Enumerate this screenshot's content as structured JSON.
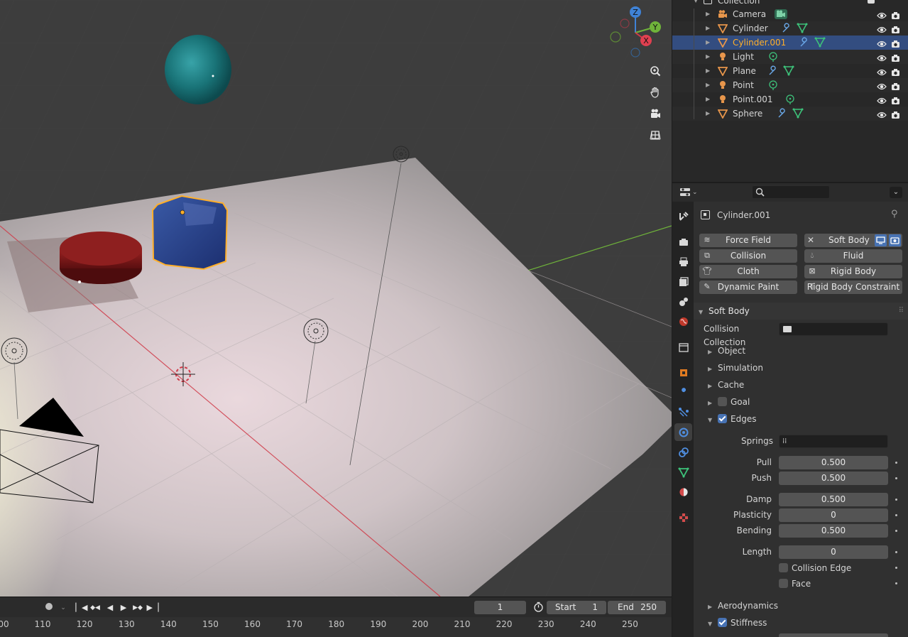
{
  "outliner": {
    "header_label": "Collection",
    "items": [
      {
        "name": "Camera",
        "type": "camera"
      },
      {
        "name": "Cylinder",
        "type": "mesh"
      },
      {
        "name": "Cylinder.001",
        "type": "mesh",
        "selected": true
      },
      {
        "name": "Light",
        "type": "light"
      },
      {
        "name": "Plane",
        "type": "mesh"
      },
      {
        "name": "Point",
        "type": "light"
      },
      {
        "name": "Point.001",
        "type": "light"
      },
      {
        "name": "Sphere",
        "type": "mesh"
      }
    ]
  },
  "properties": {
    "object_name": "Cylinder.001",
    "physics_buttons": {
      "force_field": "Force Field",
      "soft_body": "Soft Body",
      "collision": "Collision",
      "fluid": "Fluid",
      "cloth": "Cloth",
      "rigid_body": "Rigid Body",
      "dynamic_paint": "Dynamic Paint",
      "rigid_body_constraint": "Rigid Body Constraint"
    },
    "panel_title": "Soft Body",
    "collision_collection_label": "Collision Collection",
    "subpanels": {
      "object": "Object",
      "simulation": "Simulation",
      "cache": "Cache",
      "goal": "Goal",
      "edges": "Edges",
      "aerodynamics": "Aerodynamics",
      "stiffness": "Stiffness"
    },
    "edges": {
      "springs_label": "Springs",
      "pull_label": "Pull",
      "pull_value": "0.500",
      "push_label": "Push",
      "push_value": "0.500",
      "damp_label": "Damp",
      "damp_value": "0.500",
      "plasticity_label": "Plasticity",
      "plasticity_value": "0",
      "bending_label": "Bending",
      "bending_value": "0.500",
      "length_label": "Length",
      "length_value": "0",
      "collision_edge_label": "Collision Edge",
      "face_label": "Face"
    }
  },
  "timeline": {
    "current_frame": "1",
    "start_label": "Start",
    "start_value": "1",
    "end_label": "End",
    "end_value": "250",
    "ticks": [
      "00",
      "110",
      "120",
      "130",
      "140",
      "150",
      "160",
      "170",
      "180",
      "190",
      "200",
      "210",
      "220",
      "230",
      "240",
      "250"
    ]
  },
  "gizmo": {
    "z": "Z",
    "y": "Y",
    "x": "X"
  },
  "colors": {
    "selection": "#ffaf29",
    "selected_row": "#334d80",
    "accent_blue": "#4772b3",
    "x_axis": "#d03a48",
    "y_axis": "#6fb33a",
    "z_axis": "#3f82d6"
  }
}
